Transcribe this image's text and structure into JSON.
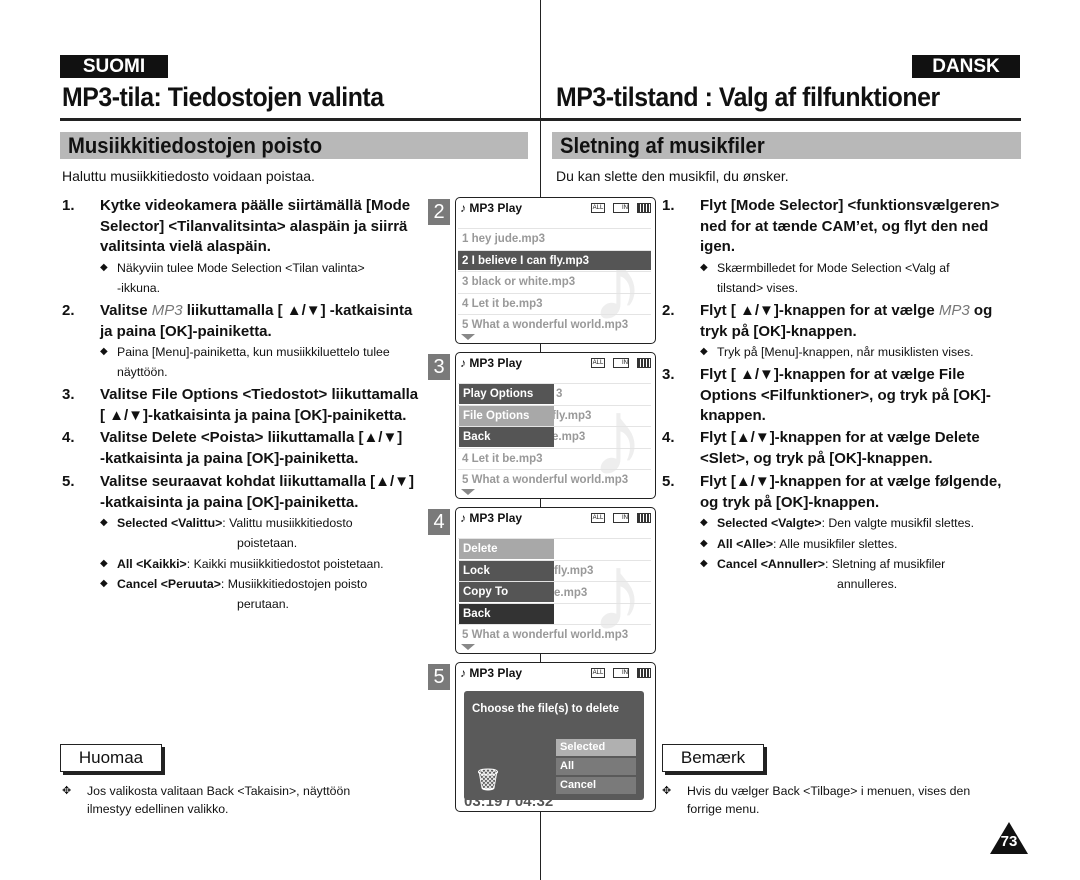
{
  "left": {
    "lang": "SUOMI",
    "title": "MP3-tila: Tiedostojen valinta",
    "section": "Musiikkitiedostojen poisto",
    "intro": "Haluttu musiikkitiedosto voidaan poistaa.",
    "steps": [
      {
        "n": "1.",
        "lines": [
          "Kytke videokamera päälle siirtämällä [Mode",
          "Selector] <Tilanvalitsinta> alaspäin ja siirrä",
          "valitsinta vielä alaspäin."
        ]
      },
      {
        "n": "2.",
        "lines": [
          "Valitse MP3 liikuttamalla [ ▲/▼] -katkaisinta",
          "ja paina [OK]-painiketta."
        ],
        "italic": "MP3"
      },
      {
        "n": "3.",
        "lines": [
          "Valitse File Options <Tiedostot> liikuttamalla",
          "[ ▲/▼]-katkaisinta ja paina [OK]-painiketta."
        ]
      },
      {
        "n": "4.",
        "lines": [
          "Valitse Delete <Poista> liikuttamalla [▲/▼]",
          "-katkaisinta ja paina [OK]-painiketta."
        ]
      },
      {
        "n": "5.",
        "lines": [
          "Valitse seuraavat kohdat liikuttamalla [▲/▼]",
          "-katkaisinta ja paina [OK]-painiketta."
        ]
      }
    ],
    "bullets": [
      {
        "lines": [
          "Näkyviin tulee Mode Selection <Tilan valinta>",
          "-ikkuna."
        ]
      },
      {
        "lines": [
          "Paina [Menu]-painiketta, kun musiikkiluettelo tulee",
          "näyttöön."
        ]
      },
      {
        "bold": "Selected <Valittu>",
        "text": ": Valittu musiikkitiedosto",
        "cont": "poistetaan."
      },
      {
        "bold": "All <Kaikki>",
        "text": ": Kaikki musiikkitiedostot poistetaan."
      },
      {
        "bold": "Cancel <Peruuta>",
        "text": ": Musiikkitiedostojen poisto",
        "cont": "perutaan."
      }
    ],
    "note_label": "Huomaa",
    "note_lines": [
      "Jos valikosta valitaan Back <Takaisin>, näyttöön",
      "ilmestyy edellinen valikko."
    ]
  },
  "right": {
    "lang": "DANSK",
    "title": "MP3-tilstand : Valg af filfunktioner",
    "section": "Sletning af musikfiler",
    "intro": "Du kan slette den musikfil, du ønsker.",
    "steps": [
      {
        "n": "1.",
        "lines": [
          "Flyt [Mode Selector] <funktionsvælgeren>",
          "ned for at tænde CAM’et, og flyt den ned",
          "igen."
        ]
      },
      {
        "n": "2.",
        "lines": [
          "Flyt [ ▲/▼]-knappen for at vælge MP3 og",
          "tryk på [OK]-knappen."
        ]
      },
      {
        "n": "3.",
        "lines": [
          "Flyt [ ▲/▼]-knappen for at vælge File",
          "Options <Filfunktioner>, og tryk på [OK]-",
          "knappen."
        ]
      },
      {
        "n": "4.",
        "lines": [
          "Flyt  [▲/▼]-knappen for at vælge Delete",
          "<Slet>, og tryk på [OK]-knappen."
        ]
      },
      {
        "n": "5.",
        "lines": [
          "Flyt [▲/▼]-knappen for at vælge følgende,",
          "og tryk på [OK]-knappen."
        ]
      }
    ],
    "bullets": [
      {
        "lines": [
          "Skærmbilledet for Mode Selection <Valg af",
          "tilstand> vises."
        ]
      },
      {
        "lines": [
          "Tryk på [Menu]-knappen, når musiklisten vises."
        ]
      },
      {
        "bold": "Selected <Valgte>",
        "text": ": Den valgte musikfil slettes."
      },
      {
        "bold": "All <Alle>",
        "text": ": Alle musikfiler slettes."
      },
      {
        "bold": "Cancel <Annuller>",
        "text": ": Sletning af musikfiler",
        "cont": "annulleres."
      }
    ],
    "note_label": "Bemærk",
    "note_lines": [
      "Hvis du vælger Back <Tilbage> i menuen, vises den",
      "forrige menu."
    ]
  },
  "screens": {
    "header": "MP3 Play",
    "icon_all": "ALL",
    "icon_in": "IN",
    "files": [
      "1  hey jude.mp3",
      "2  I believe I can fly.mp3",
      "3  black or white.mp3",
      "4  Let it be.mp3",
      "5  What a wonderful world.mp3"
    ],
    "s2": {
      "num": "2",
      "selected_index": 1
    },
    "s3": {
      "num": "3",
      "menu": [
        "Play Options",
        "File Options",
        "Back"
      ],
      "highlight": "File Options",
      "peek": [
        "3",
        "fly.mp3",
        "e.mp3"
      ]
    },
    "s4": {
      "num": "4",
      "menu": [
        "Delete",
        "Lock",
        "Copy To",
        "Back"
      ],
      "highlight": "Delete",
      "peek": [
        "fly.mp3",
        "e.mp3"
      ]
    },
    "s5": {
      "num": "5",
      "dialog_title": "Choose the file(s) to delete",
      "options": [
        "Selected",
        "All",
        "Cancel"
      ],
      "highlight": "Selected",
      "time": "03:19 / 04:32"
    }
  },
  "page_number": "73",
  "colors": {
    "section_bg": "#b8b8b8",
    "menu_dark": "#555555",
    "menu_highlight": "#a8a8a8"
  }
}
